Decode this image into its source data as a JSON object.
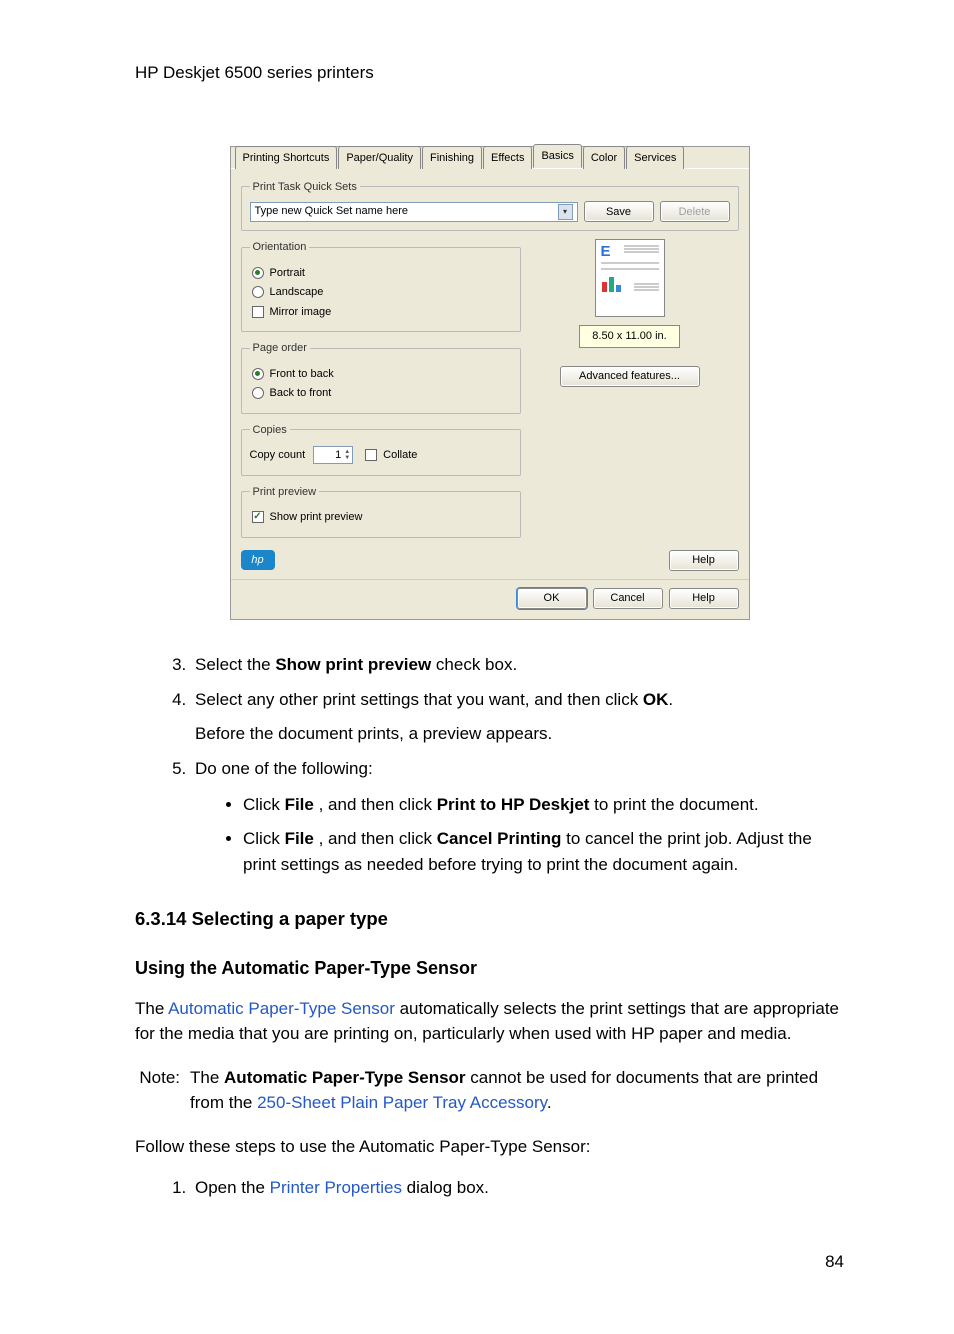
{
  "header": {
    "title": "HP Deskjet 6500 series printers"
  },
  "dialog": {
    "tabs": [
      "Printing Shortcuts",
      "Paper/Quality",
      "Finishing",
      "Effects",
      "Basics",
      "Color",
      "Services"
    ],
    "active_tab": "Basics",
    "quicksets": {
      "legend": "Print Task Quick Sets",
      "placeholder": "Type new Quick Set name here",
      "save": "Save",
      "delete": "Delete"
    },
    "orientation": {
      "legend": "Orientation",
      "portrait": "Portrait",
      "landscape": "Landscape",
      "mirror": "Mirror image"
    },
    "page_order": {
      "legend": "Page order",
      "ftb": "Front to back",
      "btf": "Back to front"
    },
    "copies": {
      "legend": "Copies",
      "copy_count": "Copy count",
      "value": "1",
      "collate": "Collate"
    },
    "print_preview": {
      "legend": "Print preview",
      "show": "Show print preview"
    },
    "paper_size": "8.50 x 11.00 in.",
    "advanced": "Advanced features...",
    "help_inner": "Help",
    "buttons": {
      "ok": "OK",
      "cancel": "Cancel",
      "help": "Help"
    }
  },
  "steps": {
    "s3_a": "Select the ",
    "s3_b": "Show print preview",
    "s3_c": " check box.",
    "s4_a": "Select any other print settings that you want, and then click ",
    "s4_b": "OK",
    "s4_c": ".",
    "s4_sub": "Before the document prints, a preview appears.",
    "s5": "Do one of the following:",
    "s5b1_a": "Click ",
    "s5b1_b": "File",
    "s5b1_c": " , and then click ",
    "s5b1_d": "Print to HP Deskjet",
    "s5b1_e": " to print the document.",
    "s5b2_a": "Click ",
    "s5b2_b": "File",
    "s5b2_c": " , and then click ",
    "s5b2_d": "Cancel Printing",
    "s5b2_e": " to cancel the print job. Adjust the print settings as needed before trying to print the document again."
  },
  "section": {
    "num_title": "6.3.14  Selecting a paper type",
    "h3": "Using the Automatic Paper-Type Sensor",
    "p1_a": "The ",
    "p1_link": "Automatic Paper-Type Sensor",
    "p1_b": " automatically selects the print settings that are appropriate for the media that you are printing on, particularly when used with HP paper and media.",
    "note_label": "Note:",
    "note_a": "The ",
    "note_b": "Automatic Paper-Type Sensor",
    "note_c": " cannot be used for documents that are printed from the ",
    "note_link": "250-Sheet Plain Paper Tray Accessory",
    "note_d": ".",
    "p2": "Follow these steps to use the Automatic Paper-Type Sensor:",
    "st1_a": "Open the ",
    "st1_link": "Printer Properties",
    "st1_b": " dialog box."
  },
  "page_number": "84"
}
